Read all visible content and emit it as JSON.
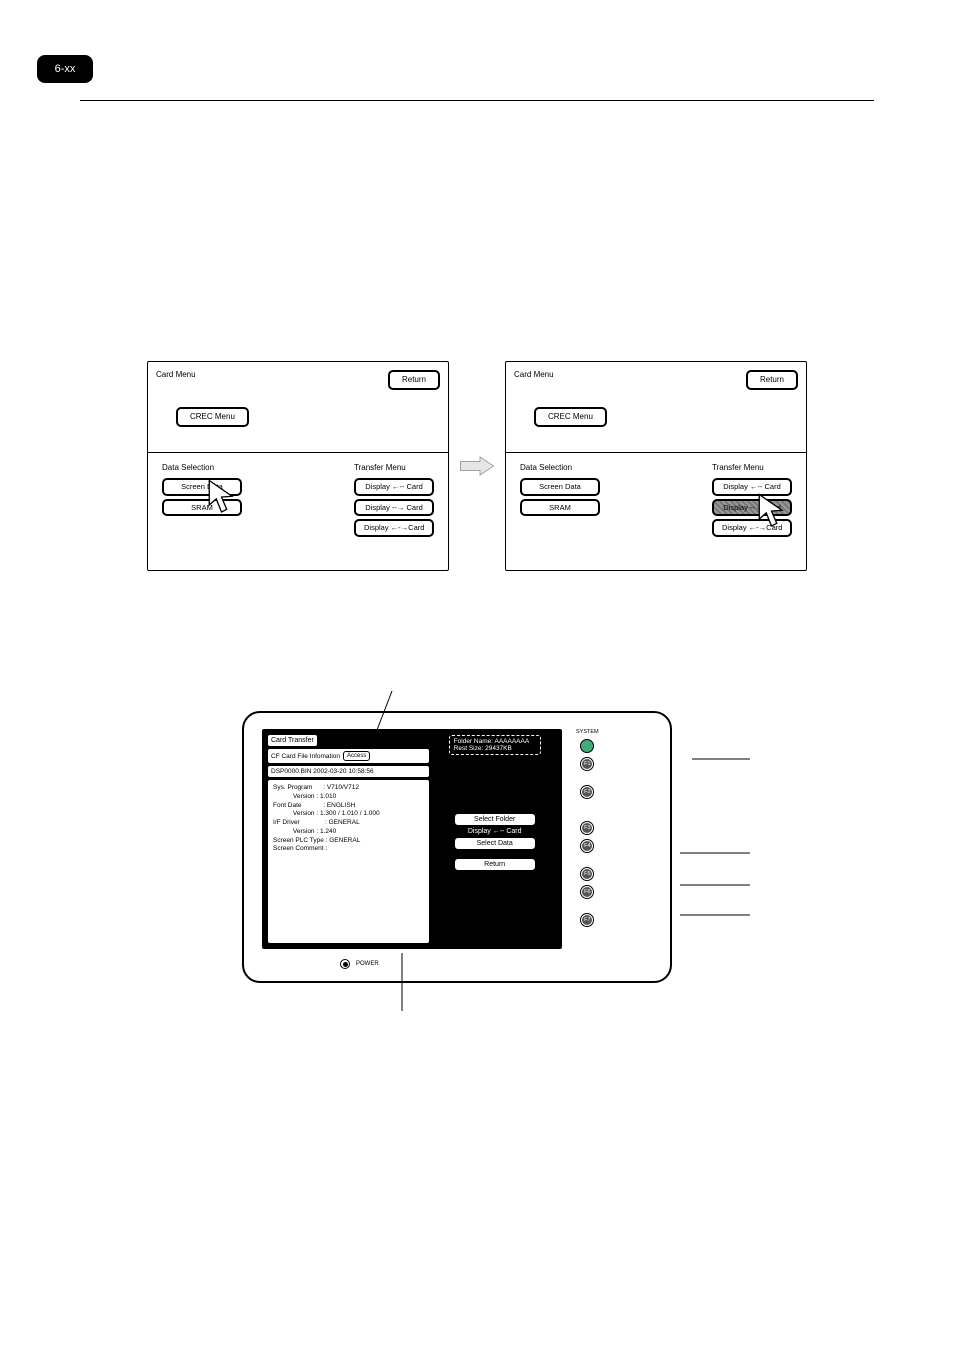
{
  "page": {
    "tab": "6-xx"
  },
  "panelA": {
    "title": "Card Menu",
    "return": "Return",
    "crec": "CREC Menu",
    "leftGroup": "Data Selection",
    "leftBtn1": "Screen Data",
    "leftBtn2": "SRAM",
    "rightGroup": "Transfer Menu",
    "rightBtn1": "Display ←-- Card",
    "rightBtn2": "Display --→ Card",
    "rightBtn3": "Display ←-→Card"
  },
  "panelB": {
    "title": "Card Menu",
    "return": "Return",
    "crec": "CREC Menu",
    "leftGroup": "Data Selection",
    "leftBtn1": "Screen Data",
    "leftBtn2": "SRAM",
    "rightGroup": "Transfer Menu",
    "rightBtn1": "Display ←-- Card",
    "rightBtn2": "Display --→ Card",
    "rightBtn3": "Display ←-→Card"
  },
  "device": {
    "cardTransfer": "Card Transfer",
    "fileInfo": "CF Card File Infomation",
    "access": "Access",
    "fileLine": "DSP0000.BIN     2002-03-20     10:58:56",
    "info": "Sys. Program      : V710/V712\n           Version : 1.010\nFont Date            : ENGLISH\n           Version : 1.300 / 1.010 / 1.000\nI/F Driver              : GENERAL\n           Version : 1.240\nScreen PLC Type : GENERAL\nScreen Comment :",
    "folderLine1": "Folder Name: AAAAAAAA",
    "folderLine2": "Rest Size:     29437KB",
    "selectFolder": "Select Folder",
    "dispCard": "Display ←-- Card",
    "selectData": "Select Data",
    "return": "Return",
    "power": "POWER",
    "system": "SYSTEM",
    "fns": [
      "F1",
      "F2",
      "F3",
      "F4",
      "F5",
      "F6",
      "F7"
    ]
  }
}
